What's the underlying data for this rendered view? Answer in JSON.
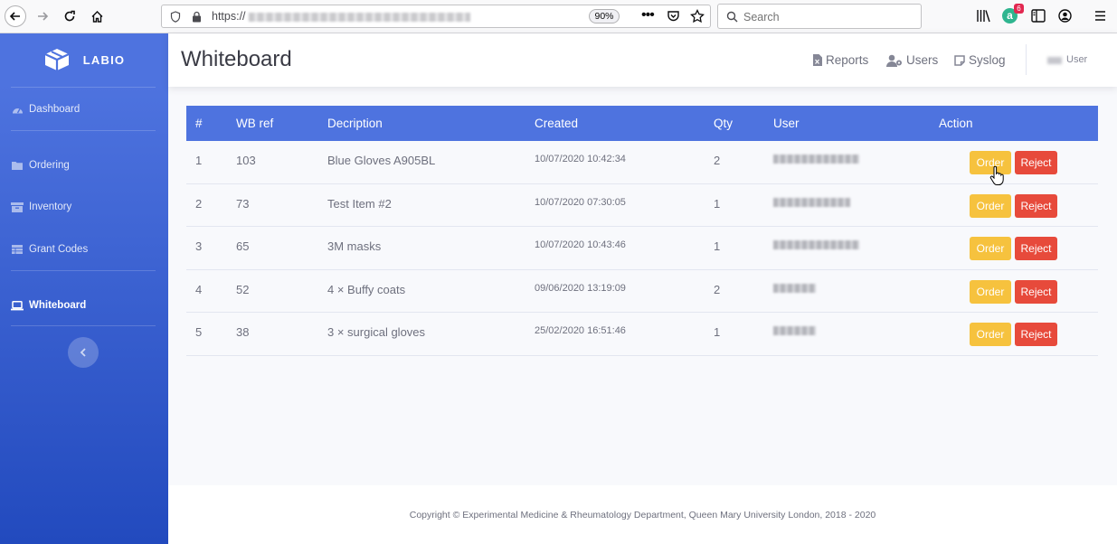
{
  "browser": {
    "url_prefix": "https://",
    "zoom": "90%",
    "search_placeholder": "Search",
    "addon_badge": "6"
  },
  "sidebar": {
    "brand": "LABIO",
    "items": [
      {
        "label": "Dashboard"
      },
      {
        "label": "Ordering"
      },
      {
        "label": "Inventory"
      },
      {
        "label": "Grant Codes"
      },
      {
        "label": "Whiteboard"
      }
    ]
  },
  "topbar": {
    "title": "Whiteboard",
    "links": {
      "reports": "Reports",
      "users": "Users",
      "syslog": "Syslog"
    },
    "user_label": "User"
  },
  "table": {
    "headers": [
      "#",
      "WB ref",
      "Decription",
      "Created",
      "Qty",
      "User",
      "Action"
    ],
    "rows": [
      {
        "num": "1",
        "ref": "103",
        "desc": "Blue Gloves A905BL",
        "created": "10/07/2020 10:42:34",
        "qty": "2"
      },
      {
        "num": "2",
        "ref": "73",
        "desc": "Test Item #2",
        "created": "10/07/2020 07:30:05",
        "qty": "1"
      },
      {
        "num": "3",
        "ref": "65",
        "desc": "3M masks",
        "created": "10/07/2020 10:43:46",
        "qty": "1"
      },
      {
        "num": "4",
        "ref": "52",
        "desc": "4 × Buffy coats",
        "created": "09/06/2020 13:19:09",
        "qty": "2"
      },
      {
        "num": "5",
        "ref": "38",
        "desc": "3 × surgical gloves",
        "created": "25/02/2020 16:51:46",
        "qty": "1"
      }
    ],
    "order_label": "Order",
    "reject_label": "Reject"
  },
  "footer": {
    "text": "Copyright © Experimental Medicine & Rheumatology Department, Queen Mary University London, 2018 - 2020"
  },
  "colors": {
    "primary": "#4e73df",
    "warning": "#f6c23e",
    "danger": "#e74a3b"
  }
}
